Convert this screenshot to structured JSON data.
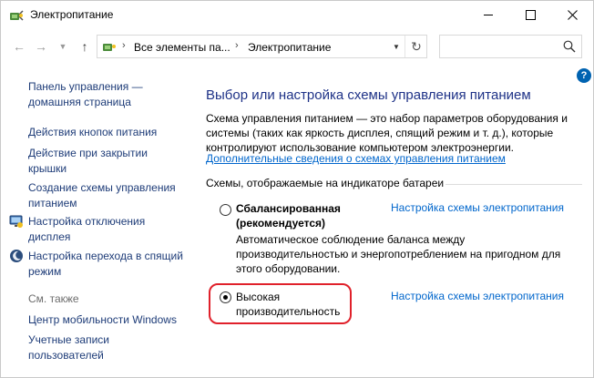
{
  "window": {
    "title": "Электропитание",
    "minimize_icon": "minimize-icon",
    "maximize_icon": "maximize-icon",
    "close_icon": "close-icon"
  },
  "nav": {
    "breadcrumb": [
      "Все элементы па...",
      "Электропитание"
    ],
    "search_placeholder": ""
  },
  "left_pane": {
    "home_link": "Панель управления — домашняя страница",
    "links": [
      {
        "label": "Действия кнопок питания"
      },
      {
        "label": "Действие при закрытии крышки"
      },
      {
        "label": "Создание схемы управления питанием"
      },
      {
        "label": "Настройка отключения дисплея",
        "icon": "display-icon"
      },
      {
        "label": "Настройка перехода в спящий режим",
        "icon": "sleep-moon-icon"
      }
    ],
    "see_also_title": "См. также",
    "see_also_links": [
      {
        "label": "Центр мобильности Windows"
      },
      {
        "label": "Учетные записи пользователей"
      }
    ]
  },
  "main": {
    "heading": "Выбор или настройка схемы управления питанием",
    "description": "Схема управления питанием — это набор параметров оборудования и системы (таких как яркость дисплея, спящий режим и т. д.), которые контролируют использование компьютером электроэнергии.",
    "more_info_link": "Дополнительные сведения о схемах управления питанием",
    "plans_group_label": "Схемы, отображаемые на индикаторе батареи",
    "plans": [
      {
        "name": "Сбалансированная (рекомендуется)",
        "selected": false,
        "settings_link": "Настройка схемы электропитания",
        "description": "Автоматическое соблюдение баланса между производительностью и энергопотреблением на пригодном для этого оборудовании."
      },
      {
        "name": "Высокая производительность",
        "selected": true,
        "settings_link": "Настройка схемы электропитания"
      }
    ]
  },
  "colors": {
    "link": "#0066cc",
    "left_link": "#1e3c78",
    "heading": "#1e3287",
    "highlight": "#e0212b"
  }
}
